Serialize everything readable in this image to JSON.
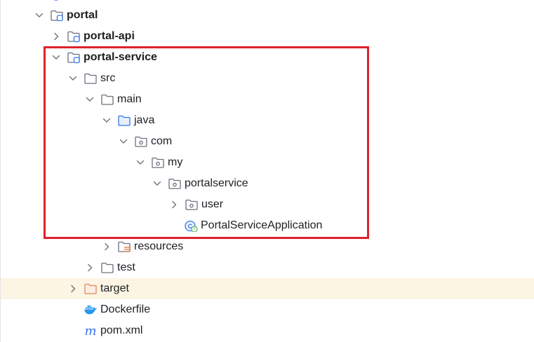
{
  "tree": {
    "items": [
      {
        "label": "portal",
        "icon": "module-folder-icon",
        "expanded": true,
        "bold": true
      },
      {
        "label": "portal-api",
        "icon": "module-folder-icon",
        "expanded": false,
        "bold": true
      },
      {
        "label": "portal-service",
        "icon": "module-folder-icon",
        "expanded": true,
        "bold": true
      },
      {
        "label": "src",
        "icon": "folder-icon",
        "expanded": true
      },
      {
        "label": "main",
        "icon": "folder-icon",
        "expanded": true
      },
      {
        "label": "java",
        "icon": "source-root-folder-icon",
        "expanded": true
      },
      {
        "label": "com",
        "icon": "package-icon",
        "expanded": true
      },
      {
        "label": "my",
        "icon": "package-icon",
        "expanded": true
      },
      {
        "label": "portalservice",
        "icon": "package-icon",
        "expanded": true
      },
      {
        "label": "user",
        "icon": "package-icon",
        "expanded": false
      },
      {
        "label": "PortalServiceApplication",
        "icon": "spring-boot-class-icon"
      },
      {
        "label": "resources",
        "icon": "resources-folder-icon",
        "expanded": false
      },
      {
        "label": "test",
        "icon": "folder-icon",
        "expanded": false
      },
      {
        "label": "target",
        "icon": "excluded-folder-icon",
        "expanded": false,
        "highlighted": true
      },
      {
        "label": "Dockerfile",
        "icon": "docker-icon"
      },
      {
        "label": "pom.xml",
        "icon": "maven-icon"
      }
    ]
  },
  "colors": {
    "selection_box": "#e0212b",
    "highlight_row": "#fdf5e4",
    "folder_stroke": "#6c707e",
    "source_root": "#3574f0",
    "excluded_folder": "#e08855",
    "text": "#1e1f22"
  }
}
